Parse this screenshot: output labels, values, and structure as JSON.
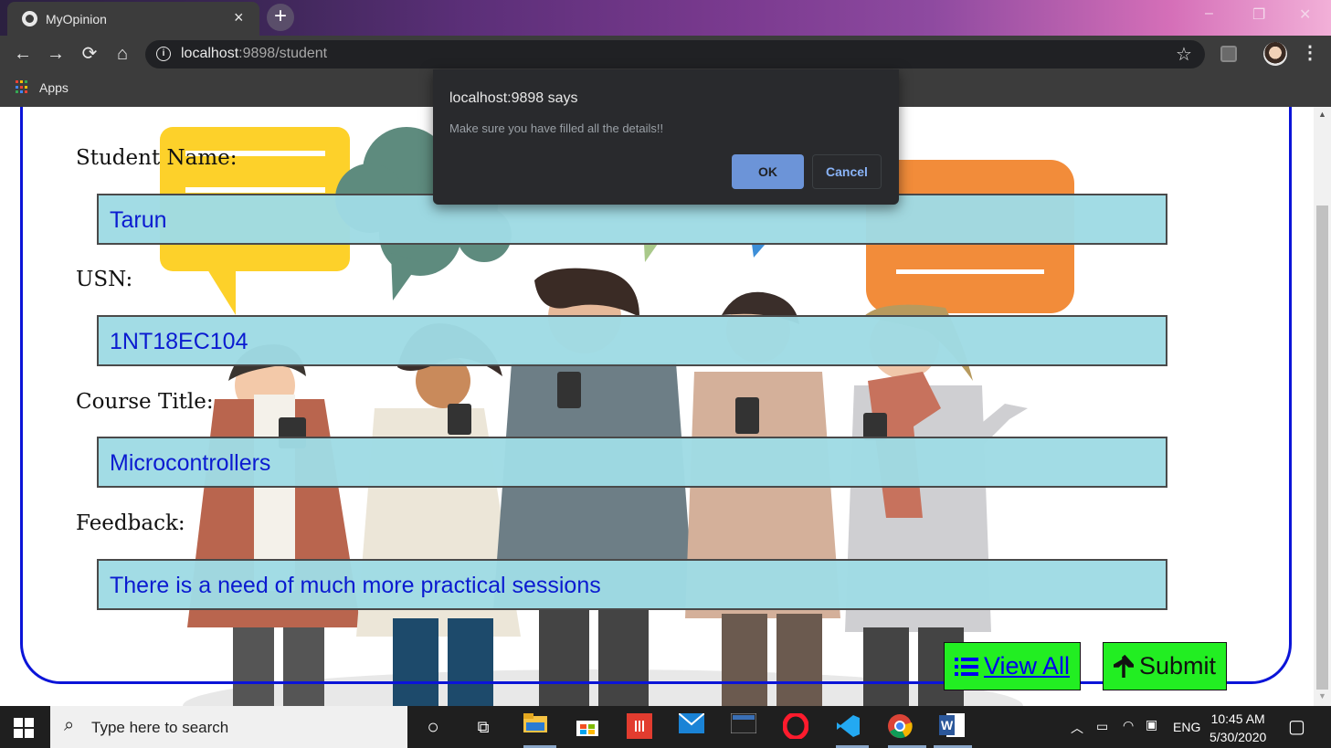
{
  "browser": {
    "tab_title": "MyOpinion",
    "tab_close": "×",
    "new_tab": "+",
    "url_host": "localhost",
    "url_path": ":9898/student",
    "bookmarks_apps": "Apps",
    "window_controls": {
      "minimize": "–",
      "restore": "❐",
      "close": "✕"
    },
    "nav": {
      "back": "←",
      "forward": "→",
      "reload": "⟳",
      "home": "⌂",
      "star": "☆",
      "menu": "⋮"
    }
  },
  "dialog": {
    "title": "localhost:9898 says",
    "message": "Make sure you have filled all the details!!",
    "ok_label": "OK",
    "cancel_label": "Cancel"
  },
  "form": {
    "fields": [
      {
        "label": "Student Name:",
        "value": "Tarun"
      },
      {
        "label": "USN:",
        "value": "1NT18EC104"
      },
      {
        "label": "Course Title:",
        "value": "Microcontrollers"
      },
      {
        "label": "Feedback:",
        "value": "There is a need of much more practical sessions"
      }
    ],
    "view_all_label": "View All",
    "submit_label": "Submit",
    "view_all_icon": "list-icon",
    "submit_icon": "arrow-up-icon",
    "border_color": "#0b14d8",
    "button_color": "#22ee22",
    "field_bg": "#9fdbe4",
    "field_text_color": "#0b1bd0"
  },
  "taskbar": {
    "search_placeholder": "Type here to search",
    "language": "ENG",
    "time": "10:45 AM",
    "date": "5/30/2020",
    "pinned_apps": [
      "cortana-icon",
      "task-view-icon",
      "file-explorer-icon",
      "store-icon",
      "app-icon",
      "mail-icon",
      "mysql-icon",
      "opera-icon",
      "vscode-icon",
      "chrome-icon",
      "word-icon"
    ]
  }
}
